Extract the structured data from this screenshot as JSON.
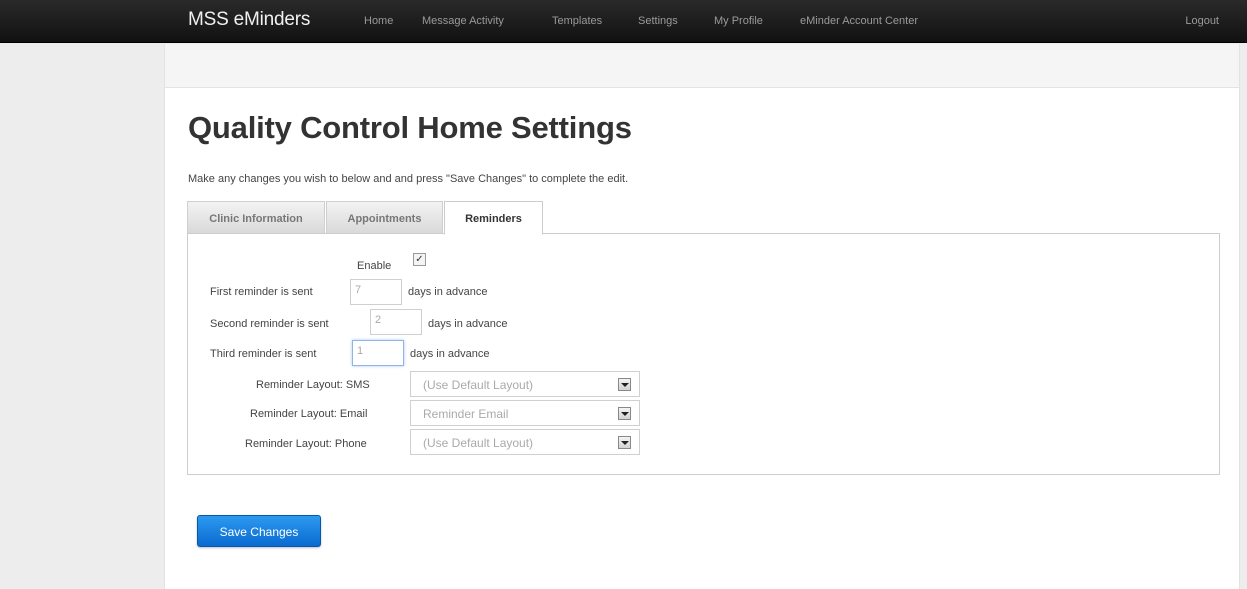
{
  "nav": {
    "brand": "MSS eMinders",
    "links": [
      "Home",
      "Message Activity",
      "Templates",
      "Settings",
      "My Profile",
      "eMinder Account Center"
    ],
    "logout": "Logout"
  },
  "page": {
    "title": "Quality Control Home Settings",
    "intro": "Make any changes you wish to below and and press \"Save Changes\" to complete the edit."
  },
  "tabs": [
    "Clinic Information",
    "Appointments",
    "Reminders"
  ],
  "active_tab": "Reminders",
  "reminders": {
    "enable_label": "Enable",
    "enable_checked": true,
    "first_label": "First reminder is sent",
    "first_value": "7",
    "second_label": "Second reminder is sent",
    "second_value": "2",
    "third_label": "Third reminder is sent",
    "third_value": "1",
    "days_suffix": "days in advance",
    "sms_label": "Reminder Layout: SMS",
    "sms_value": "(Use Default Layout)",
    "email_label": "Reminder Layout: Email",
    "email_value": "Reminder Email",
    "phone_label": "Reminder Layout: Phone",
    "phone_value": "(Use Default Layout)"
  },
  "save_button": "Save Changes",
  "colors": {
    "navbar": "#1b1b1b",
    "primary_button": "#1a7fe0"
  }
}
